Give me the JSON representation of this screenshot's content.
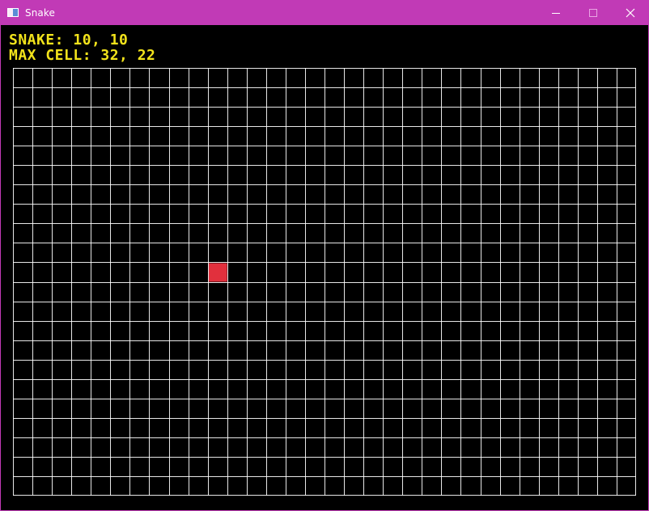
{
  "window": {
    "title": "Snake",
    "icon": "app-window-icon",
    "controls": {
      "minimize": "minimize-icon",
      "maximize": "maximize-icon",
      "close": "close-icon"
    },
    "accent_color": "#c13ab6"
  },
  "hud": {
    "snake_label": "SNAKE: 10, 10",
    "max_cell_label": "MAX CELL: 32, 22",
    "text_color": "#f2e31b"
  },
  "board": {
    "columns": 32,
    "rows": 22,
    "grid_color": "#ffffff",
    "background": "#000000",
    "snake": {
      "head": [
        10,
        10
      ],
      "color": "#e1303d"
    }
  }
}
